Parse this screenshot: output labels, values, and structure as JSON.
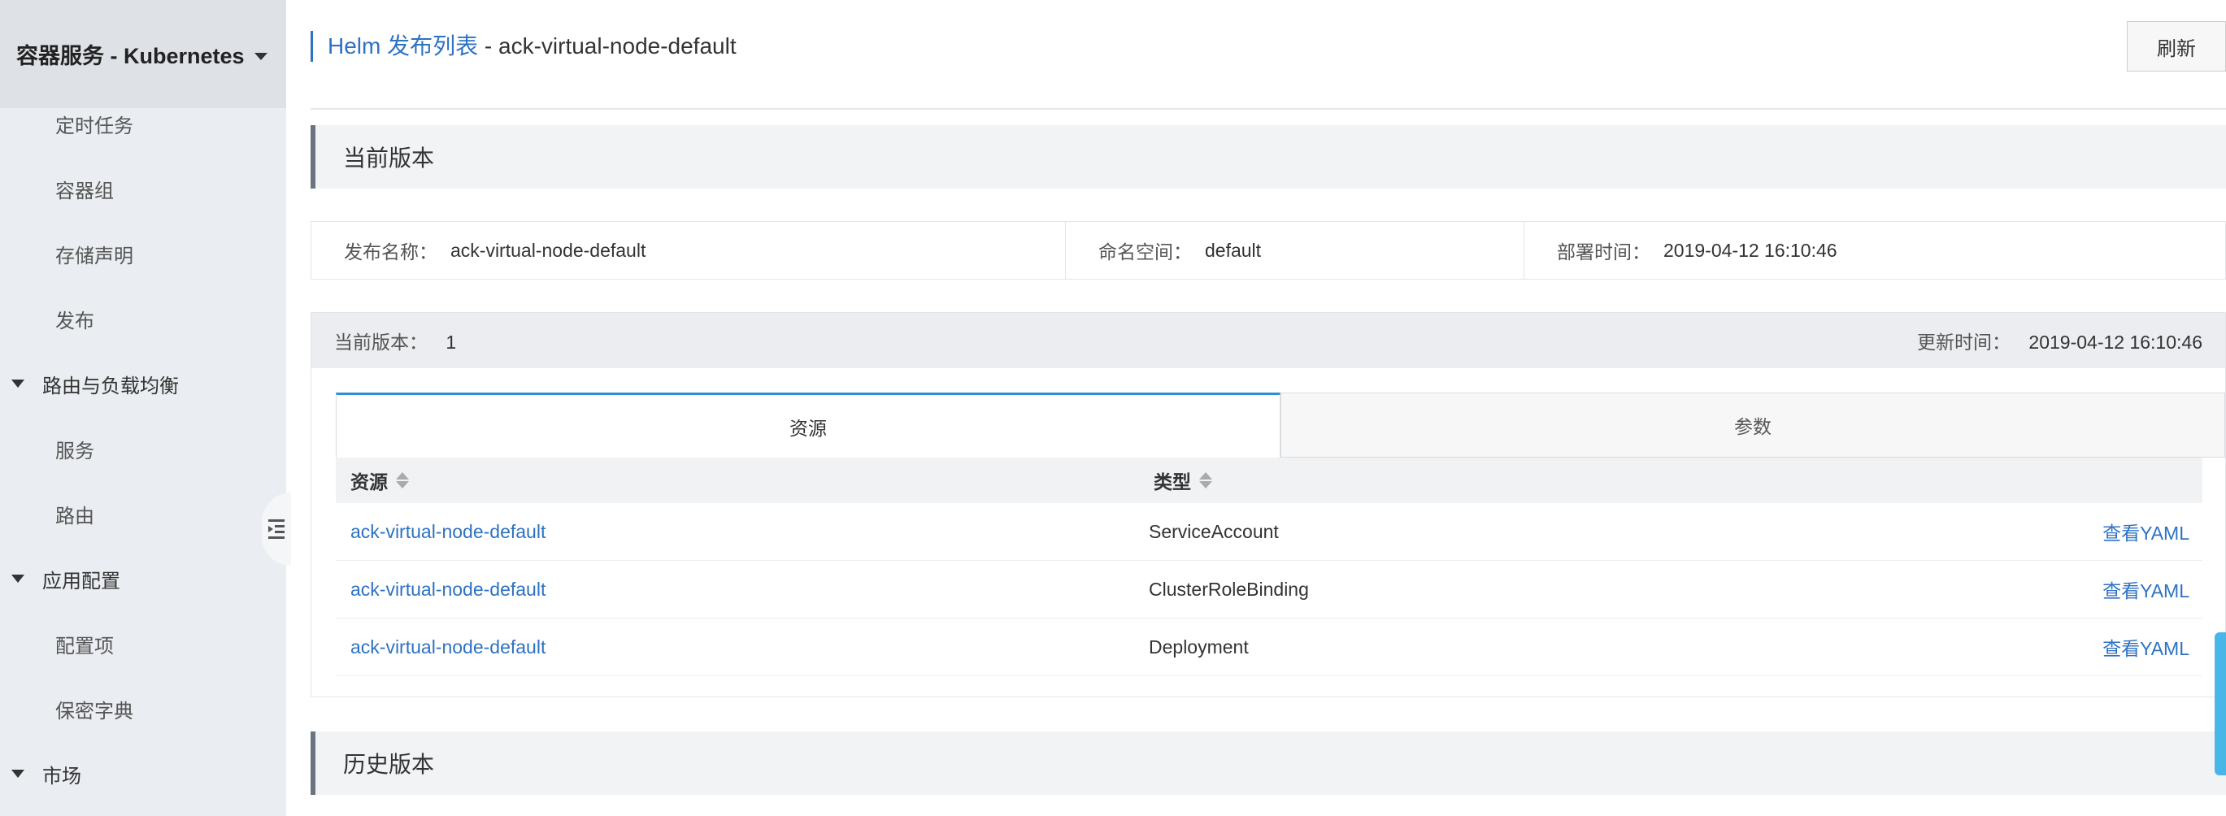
{
  "sidebar": {
    "title": "容器服务 - Kubernetes",
    "items": [
      {
        "label": "定时任务"
      },
      {
        "label": "容器组"
      },
      {
        "label": "存储声明"
      },
      {
        "label": "发布"
      },
      {
        "label": "路由与负载均衡"
      },
      {
        "label": "服务"
      },
      {
        "label": "路由"
      },
      {
        "label": "应用配置"
      },
      {
        "label": "配置项"
      },
      {
        "label": "保密字典"
      },
      {
        "label": "市场"
      }
    ]
  },
  "header": {
    "breadcrumb_link": "Helm 发布列表",
    "breadcrumb_current": " - ack-virtual-node-default",
    "refresh_label": "刷新"
  },
  "current_section": {
    "title": "当前版本",
    "info": {
      "release_name_label": "发布名称：",
      "release_name": "ack-virtual-node-default",
      "namespace_label": "命名空间：",
      "namespace": "default",
      "deploy_time_label": "部署时间：",
      "deploy_time": "2019-04-12 16:10:46"
    },
    "card": {
      "version_label": "当前版本：",
      "version": "1",
      "update_time_label": "更新时间：",
      "update_time": "2019-04-12 16:10:46",
      "tabs": [
        {
          "label": "资源",
          "active": true
        },
        {
          "label": "参数",
          "active": false
        }
      ],
      "table": {
        "headers": [
          "资源",
          "类型"
        ],
        "rows": [
          {
            "resource": "ack-virtual-node-default",
            "type": "ServiceAccount",
            "action": "查看YAML"
          },
          {
            "resource": "ack-virtual-node-default",
            "type": "ClusterRoleBinding",
            "action": "查看YAML"
          },
          {
            "resource": "ack-virtual-node-default",
            "type": "Deployment",
            "action": "查看YAML"
          }
        ]
      }
    }
  },
  "history_section": {
    "title": "历史版本"
  },
  "colors": {
    "link": "#2e72c2",
    "active_tab_accent": "#2e8fd6",
    "sidebar_bg": "#eaedf1"
  }
}
